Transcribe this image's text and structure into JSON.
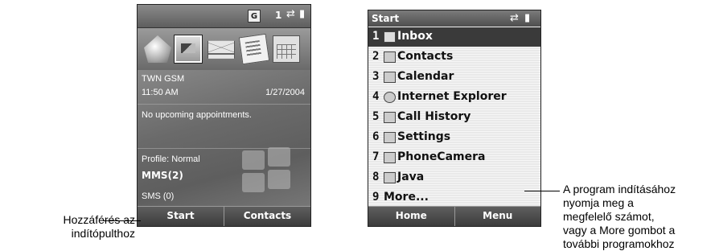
{
  "today_screen": {
    "status": {
      "g_badge": "G",
      "line_number": "1"
    },
    "carrier": "TWN GSM",
    "time": "11:50 AM",
    "date": "1/27/2004",
    "appointments": "No upcoming appointments.",
    "profile": "Profile: Normal",
    "mms": "MMS(2)",
    "sms": "SMS (0)",
    "softkeys": {
      "left": "Start",
      "right": "Contacts"
    },
    "app_icons": [
      "home-icon",
      "pictures-icon",
      "messaging-icon",
      "notes-icon",
      "calendar-icon"
    ]
  },
  "start_menu": {
    "title": "Start",
    "items": [
      {
        "num": "1",
        "label": "Inbox",
        "icon": "inbox-icon"
      },
      {
        "num": "2",
        "label": "Contacts",
        "icon": "contacts-icon"
      },
      {
        "num": "3",
        "label": "Calendar",
        "icon": "calendar-icon"
      },
      {
        "num": "4",
        "label": "Internet Explorer",
        "icon": "internet-explorer-icon"
      },
      {
        "num": "5",
        "label": "Call History",
        "icon": "call-history-icon"
      },
      {
        "num": "6",
        "label": "Settings",
        "icon": "settings-icon"
      },
      {
        "num": "7",
        "label": "PhoneCamera",
        "icon": "camera-icon"
      },
      {
        "num": "8",
        "label": "Java",
        "icon": "java-icon"
      },
      {
        "num": "9",
        "label": "More...",
        "icon": ""
      }
    ],
    "softkeys": {
      "left": "Home",
      "right": "Menu"
    }
  },
  "annotations": {
    "left": [
      "Hozzáférés az",
      "indítópulthoz"
    ],
    "right": [
      "A program indításához",
      "nyomja meg a",
      "megfelelő számot,",
      "vagy a More gombot a",
      "további programokhoz"
    ]
  }
}
